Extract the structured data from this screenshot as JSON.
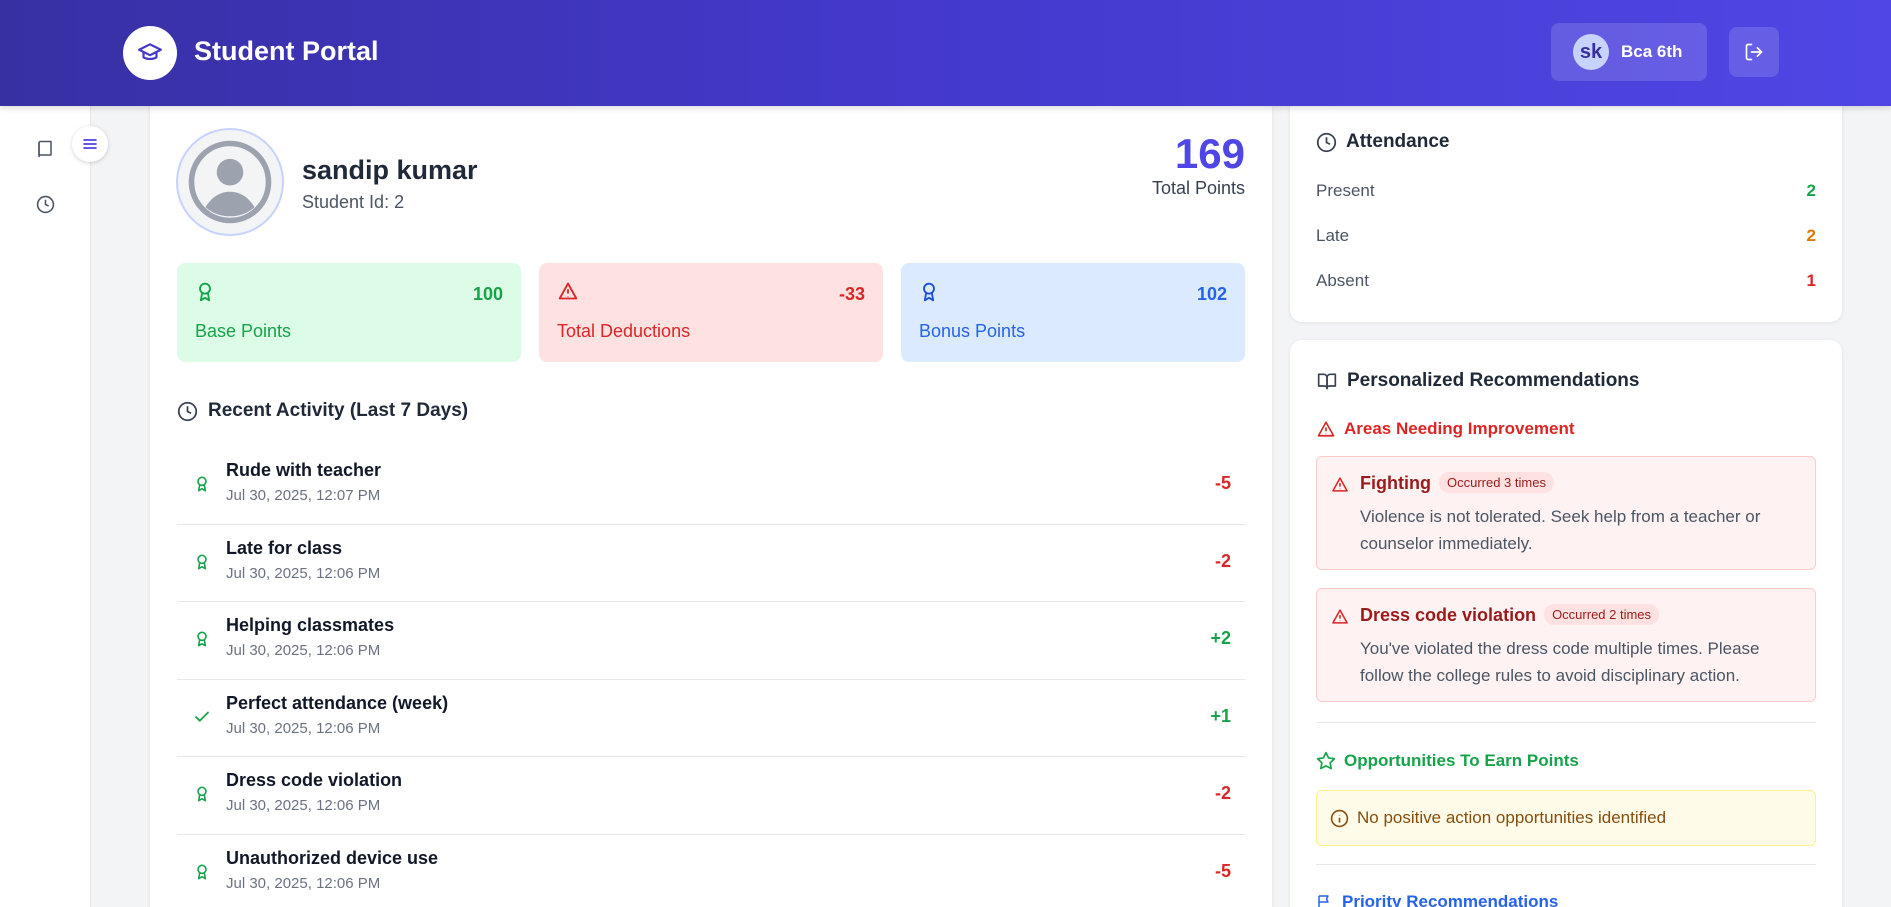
{
  "header": {
    "title": "Student Portal",
    "user_initials": "sk",
    "user_label": "Bca 6th"
  },
  "profile": {
    "name": "sandip kumar",
    "student_id": "Student Id: 2",
    "total_points": "169",
    "total_points_label": "Total Points"
  },
  "stats": [
    {
      "value": "100",
      "label": "Base Points",
      "icon": "award-icon"
    },
    {
      "value": "-33",
      "label": "Total Deductions",
      "icon": "warning-icon"
    },
    {
      "value": "102",
      "label": "Bonus Points",
      "icon": "award-icon"
    }
  ],
  "activity": {
    "title": "Recent Activity (Last 7 Days)",
    "items": [
      {
        "title": "Rude with teacher",
        "date": "Jul 30, 2025, 12:07 PM",
        "value": "-5",
        "icon": "award-icon"
      },
      {
        "title": "Late for class",
        "date": "Jul 30, 2025, 12:06 PM",
        "value": "-2",
        "icon": "award-icon"
      },
      {
        "title": "Helping classmates",
        "date": "Jul 30, 2025, 12:06 PM",
        "value": "+2",
        "icon": "award-icon"
      },
      {
        "title": "Perfect attendance (week)",
        "date": "Jul 30, 2025, 12:06 PM",
        "value": "+1",
        "icon": "check-icon"
      },
      {
        "title": "Dress code violation",
        "date": "Jul 30, 2025, 12:06 PM",
        "value": "-2",
        "icon": "award-icon"
      },
      {
        "title": "Unauthorized device use",
        "date": "Jul 30, 2025, 12:06 PM",
        "value": "-5",
        "icon": "award-icon"
      }
    ]
  },
  "attendance": {
    "title": "Attendance",
    "rows": [
      {
        "label": "Present",
        "value": "2",
        "color": "#16a34a"
      },
      {
        "label": "Late",
        "value": "2",
        "color": "#d97706"
      },
      {
        "label": "Absent",
        "value": "1",
        "color": "#dc2626"
      }
    ]
  },
  "recommendations": {
    "title": "Personalized Recommendations",
    "improvement_title": "Areas Needing Improvement",
    "issues": [
      {
        "title": "Fighting",
        "badge": "Occurred 3 times",
        "text": "Violence is not tolerated. Seek help from a teacher or counselor immediately."
      },
      {
        "title": "Dress code violation",
        "badge": "Occurred 2 times",
        "text": "You've violated the dress code multiple times. Please follow the college rules to avoid disciplinary action."
      }
    ],
    "opportunities_title": "Opportunities To Earn Points",
    "opportunities_note": "No positive action opportunities identified",
    "priority_title": "Priority Recommendations"
  },
  "colors": {
    "accent": "#4f46e5",
    "positive": "#16a34a",
    "negative": "#dc2626"
  }
}
